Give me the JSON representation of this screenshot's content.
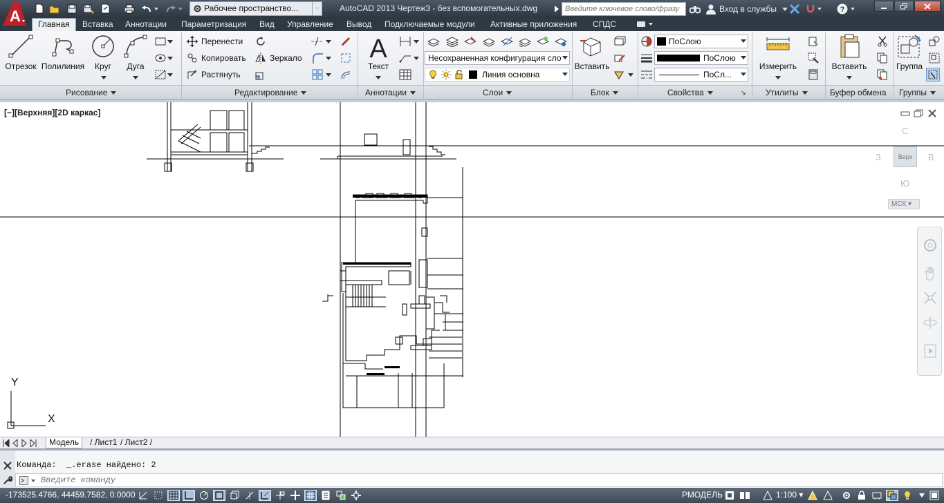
{
  "app": {
    "logo_letter": "A",
    "workspace": "Рабочее пространство...",
    "title": "AutoCAD 2013    Чертеж3 - без вспомогательных.dwg",
    "search_placeholder": "Введите ключевое слово/фразу",
    "signin_label": "Вход в службы"
  },
  "ribbon": {
    "tabs": [
      "Главная",
      "Вставка",
      "Аннотации",
      "Параметризация",
      "Вид",
      "Управление",
      "Вывод",
      "Подключаемые модули",
      "Активные приложения",
      "СПДС"
    ],
    "active_tab": "Главная",
    "draw": {
      "title": "Рисование",
      "line": "Отрезок",
      "polyline": "Полилиния",
      "circle": "Круг",
      "arc": "Дуга"
    },
    "modify": {
      "title": "Редактирование",
      "move": "Перенести",
      "copy": "Копировать",
      "stretch": "Растянуть",
      "mirror": "Зеркало"
    },
    "annotation": {
      "title": "Аннотации",
      "text": "Текст"
    },
    "layers": {
      "title": "Слои",
      "layer_state": "Несохраненная конфигурация сло",
      "current_layer": "Линия основна"
    },
    "block": {
      "title": "Блок",
      "insert": "Вставить"
    },
    "properties": {
      "title": "Свойства",
      "color": "ПоСлою",
      "lineweight": "ПоСлою",
      "linetype": "ПоСл..."
    },
    "utilities": {
      "title": "Утилиты",
      "measure": "Измерить"
    },
    "clipboard": {
      "title": "Буфер обмена",
      "paste": "Вставить"
    },
    "groups": {
      "title": "Группы",
      "group": "Группа"
    }
  },
  "viewport": {
    "label": "[−][Верхняя][2D каркас]",
    "viewcube": {
      "north": "С",
      "south": "Ю",
      "west": "З",
      "east": "В",
      "top_face": "Верх",
      "ucs": "МСК"
    },
    "ucs_x": "X",
    "ucs_y": "Y"
  },
  "layout_tabs": [
    "Модель",
    "Лист1",
    "Лист2"
  ],
  "active_layout": "Модель",
  "command": {
    "history": "Команда:  _.erase найдено: 2",
    "placeholder": "Введите команду"
  },
  "status": {
    "coordinates": "-173525.4766, 44459.7582, 0.0000",
    "space": "РМОДЕЛЬ",
    "scale": "1:100"
  },
  "colors": {
    "titlebar": "#2d3641",
    "accent": "#c0202a",
    "ribbon": "#eef1f4",
    "statusbar": "#4a5562"
  }
}
